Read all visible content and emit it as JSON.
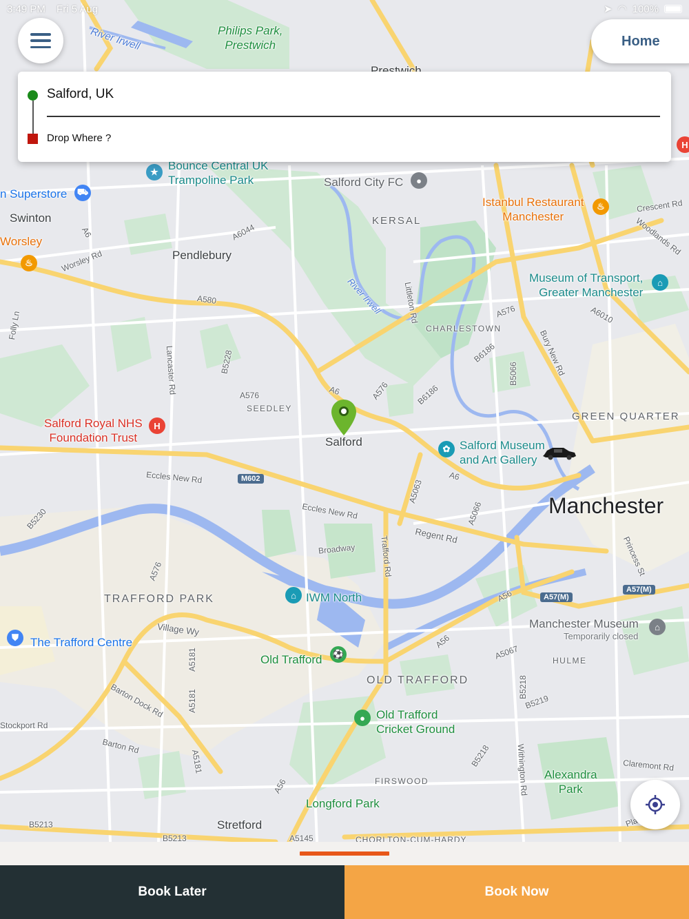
{
  "status_bar": {
    "time": "3:49 PM",
    "date": "Fri 5 Aug",
    "battery": "100%"
  },
  "header": {
    "home_label": "Home"
  },
  "location_card": {
    "pickup_value": "Salford, UK",
    "dropoff_placeholder": "Drop Where ?"
  },
  "map": {
    "labels": {
      "river_irwell_top": "River Irwell",
      "philips_park": "Philips Park,\nPrestwich",
      "prestwich": "Prestwich",
      "bounce_central": "Bounce Central UK\nTrampoline Park",
      "salford_city_fc": "Salford City FC",
      "istanbul": "Istanbul Restaurant\nManchester",
      "crescent_rd": "Crescent Rd",
      "woodlands_rd": "Woodlands Rd",
      "superstore": "n Superstore",
      "swinton": "Swinton",
      "worsley": "Worsley",
      "pendlebury": "Pendlebury",
      "kersal": "KERSAL",
      "a6044": "A6044",
      "a6_west": "A6",
      "worsley_rd": "Worsley Rd",
      "museum_transport": "Museum of Transport,\nGreater Manchester",
      "a580": "A580",
      "river_irwell_mid": "River Irwell",
      "littleton_rd": "Littleton Rd",
      "charlestown": "CHARLESTOWN",
      "a576_ne": "A576",
      "a6010": "A6010",
      "folly_ln": "Folly Ln",
      "lancaster_rd": "Lancaster Rd",
      "b5228": "B5228",
      "bury_new_rd": "Bury New Rd",
      "b6186_n": "B6186",
      "b5066": "B5066",
      "a576_sw": "A576",
      "seedley": "SEEDLEY",
      "a6_mid": "A6",
      "a576_mid": "A576",
      "b6186_s": "B6186",
      "salford_pin": "Salford",
      "green_quarter": "GREEN QUARTER",
      "salford_royal": "Salford Royal NHS\nFoundation Trust",
      "salford_museum": "Salford Museum\nand Art Gallery",
      "eccles_new_rd_w": "Eccles New Rd",
      "m602": "M602",
      "a6_east": "A6",
      "a5063": "A5063",
      "manchester": "Manchester",
      "b5230": "B5230",
      "eccles_new_rd_e": "Eccles New Rd",
      "regent_rd": "Regent Rd",
      "a5066": "A5066",
      "broadway": "Broadway",
      "trafford_rd": "Trafford Rd",
      "princess_st": "Princess St",
      "a576_s": "A576",
      "trafford_park": "TRAFFORD PARK",
      "iwm_north": "IWM North",
      "a56_e": "A56",
      "a57m_w": "A57(M)",
      "a57m_e": "A57(M)",
      "village_wy": "Village Wy",
      "trafford_centre": "The Trafford Centre",
      "manchester_museum": "Manchester Museum",
      "temporarily_closed": "Temporarily closed",
      "a56_mid": "A56",
      "a5067": "A5067",
      "hulme": "HULME",
      "a5181_n": "A5181",
      "old_trafford": "Old Trafford",
      "old_trafford_district": "OLD TRAFFORD",
      "barton_dock_rd": "Barton Dock Rd",
      "a5181_s": "A5181",
      "b5218": "B5218",
      "b5219": "B5219",
      "old_trafford_cricket": "Old Trafford\nCricket Ground",
      "stock_rd": "Stockport Rd",
      "barton_rd": "Barton Rd",
      "a5181_ss": "A5181",
      "b5218_s": "B5218",
      "withington_rd": "Withington Rd",
      "claremont_rd": "Claremont Rd",
      "alexandra_park": "Alexandra\nPark",
      "firswood": "FIRSWOOD",
      "a56_s": "A56",
      "longford_park": "Longford Park",
      "b5213_w": "B5213",
      "stretford": "Stretford",
      "b5213_s": "B5213",
      "a5145": "A5145",
      "chorlton": "CHORLTON-CUM-HARDY",
      "plat": "Plat"
    }
  },
  "actions": {
    "book_later": "Book Later",
    "book_now": "Book Now"
  },
  "colors": {
    "accent_orange": "#f4a545",
    "dark_button": "#233034",
    "handle": "#e8571a",
    "pickup_dot": "#1a8a1a",
    "dropoff_square": "#c0160d",
    "nav_blue": "#3a5f85"
  },
  "icons": {
    "menu": "hamburger-icon",
    "locate": "crosshair-icon",
    "pin": "map-pin-icon",
    "car": "car-icon"
  }
}
